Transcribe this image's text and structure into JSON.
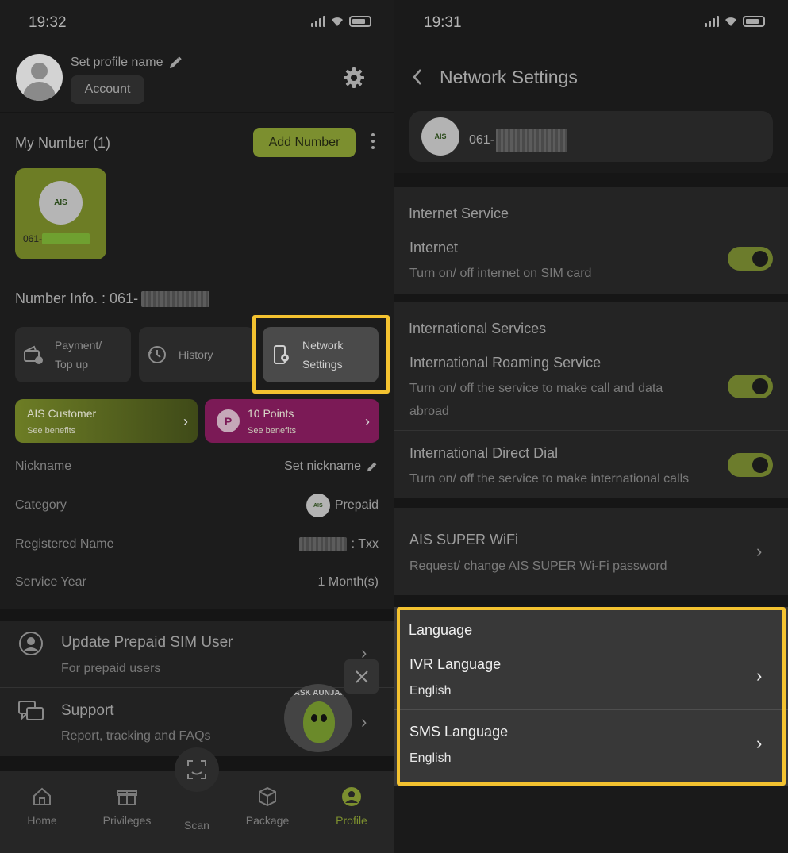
{
  "left": {
    "status_time": "19:32",
    "profile": {
      "name_label": "Set profile name",
      "account_label": "Account"
    },
    "my_number": {
      "title": "My Number (1)",
      "add_label": "Add Number",
      "sim_number": "061-"
    },
    "number_info": {
      "label": "Number Info. : 061-"
    },
    "quick_actions": [
      {
        "line1": "Payment/",
        "line2": "Top up"
      },
      {
        "line1": "History",
        "line2": ""
      },
      {
        "line1": "Network",
        "line2": "Settings"
      }
    ],
    "cards": {
      "customer": {
        "title": "AIS Customer",
        "sub": "See benefits"
      },
      "points": {
        "badge": "P",
        "title": "10 Points",
        "sub": "See benefits"
      }
    },
    "details": [
      {
        "label": "Nickname",
        "value": "Set nickname"
      },
      {
        "label": "Category",
        "value": "Prepaid"
      },
      {
        "label": "Registered Name",
        "value": ": Txx"
      },
      {
        "label": "Service Year",
        "value": "1 Month(s)"
      }
    ],
    "menu": [
      {
        "title": "Update Prepaid SIM User",
        "sub": "For prepaid users"
      },
      {
        "title": "Support",
        "sub": "Report, tracking and FAQs"
      }
    ],
    "mascot_text": "ASK AUNJAI",
    "tabs": [
      {
        "label": "Home"
      },
      {
        "label": "Privileges"
      },
      {
        "label": "Scan"
      },
      {
        "label": "Package"
      },
      {
        "label": "Profile"
      }
    ],
    "ais_logo_text": "AIS"
  },
  "right": {
    "status_time": "19:31",
    "title": "Network Settings",
    "number": "061-",
    "ais_logo_text": "AIS",
    "internet": {
      "header": "Internet Service",
      "title": "Internet",
      "sub": "Turn on/ off internet on SIM card",
      "enabled": true
    },
    "international": {
      "header": "International Services",
      "roaming": {
        "title": "International Roaming Service",
        "sub": "Turn on/ off the service to make call and data abroad",
        "enabled": true
      },
      "idd": {
        "title": "International Direct Dial",
        "sub": "Turn on/ off the service to make international calls",
        "enabled": true
      }
    },
    "wifi": {
      "title": "AIS SUPER WiFi",
      "sub": "Request/ change AIS SUPER Wi-Fi password"
    },
    "language": {
      "header": "Language",
      "ivr": {
        "title": "IVR Language",
        "value": "English"
      },
      "sms": {
        "title": "SMS Language",
        "value": "English"
      }
    }
  },
  "colors": {
    "accent": "#7c8f2f",
    "highlight": "#f3c230",
    "points": "#7b1a56"
  }
}
